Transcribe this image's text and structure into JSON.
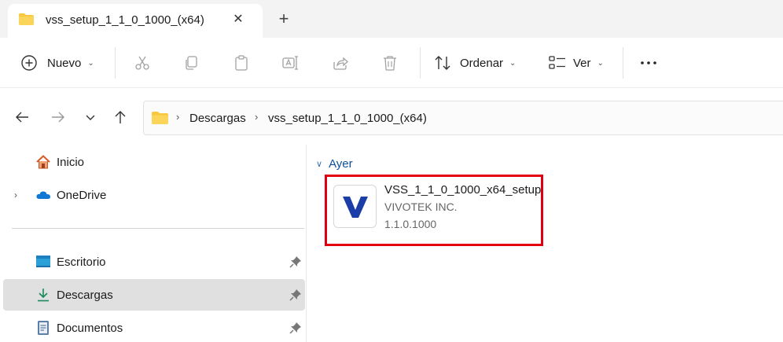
{
  "tab": {
    "title": "vss_setup_1_1_0_1000_(x64)",
    "close_icon": "close-icon",
    "new_tab_icon": "plus-icon"
  },
  "toolbar": {
    "new_label": "Nuevo",
    "sort_label": "Ordenar",
    "view_label": "Ver",
    "more_icon": "more-icon"
  },
  "address": {
    "path": [
      "Descargas",
      "vss_setup_1_1_0_1000_(x64)"
    ]
  },
  "sidebar": {
    "items": [
      {
        "label": "Inicio",
        "icon": "home-icon"
      },
      {
        "label": "OneDrive",
        "icon": "cloud-icon"
      },
      {
        "label": "Escritorio",
        "icon": "desktop-icon"
      },
      {
        "label": "Descargas",
        "icon": "download-icon"
      },
      {
        "label": "Documentos",
        "icon": "document-icon"
      }
    ]
  },
  "content": {
    "group_label": "Ayer",
    "file": {
      "name": "VSS_1_1_0_1000_x64_setup",
      "company": "VIVOTEK INC.",
      "version": "1.1.0.1000"
    }
  },
  "colors": {
    "accent": "#0067c0",
    "folder": "#f8c93e",
    "highlight_border": "#e00010",
    "logo_blue": "#1a3da8"
  }
}
